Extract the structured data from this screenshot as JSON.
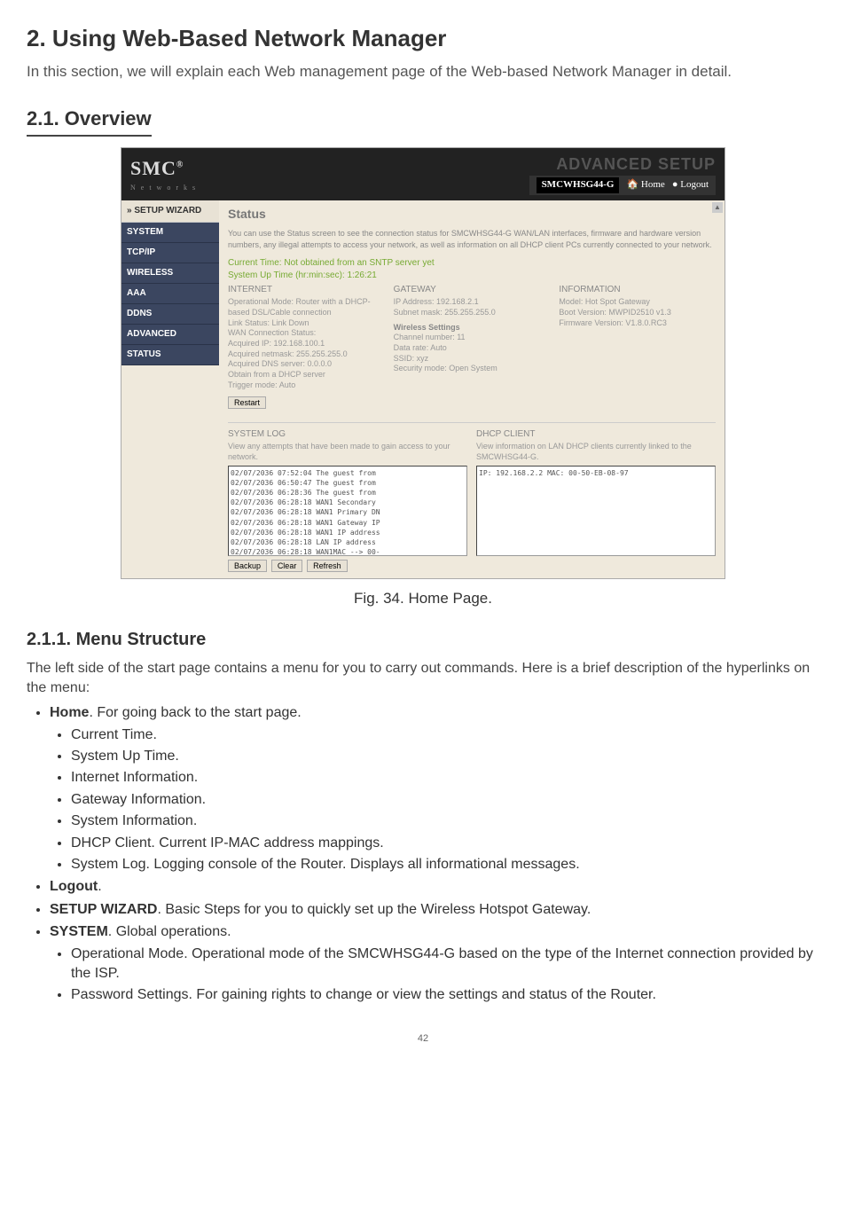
{
  "page": {
    "h1": "2. Using Web-Based Network Manager",
    "intro": "In this section, we will explain each Web management page of the Web-based Network Manager in detail.",
    "h2": "2.1. Overview",
    "caption": "Fig. 34. Home Page.",
    "h3": "2.1.1. Menu Structure",
    "menu_intro": "The left side of the start page contains a menu for you to carry out commands. Here is a brief description of the hyperlinks on the menu:",
    "bul": {
      "home_label": "Home",
      "home_rest": ". For going back to the start page.",
      "home_items": [
        "Current Time.",
        "System Up Time.",
        "Internet Information.",
        "Gateway Information.",
        "System Information.",
        "DHCP Client. Current IP-MAC address mappings.",
        "System Log. Logging console of the Router. Displays all informational messages."
      ],
      "logout": "Logout",
      "wizard_label": "SETUP WIZARD",
      "wizard_rest": ". Basic Steps for you to quickly set up the Wireless Hotspot Gateway.",
      "system_label": "SYSTEM",
      "system_rest": ". Global operations.",
      "system_items": [
        "Operational Mode. Operational mode of the SMCWHSG44-G based on the type of the Internet connection provided by the ISP.",
        "Password Settings. For gaining rights to change or view the settings and status of the Router."
      ]
    },
    "pagenum": "42"
  },
  "shot": {
    "logo": "SMC",
    "logo_sub": "N e t w o r k s",
    "adv": "ADVANCED SETUP",
    "model": "SMCWHSG44-G",
    "home_link": "Home",
    "logout_link": "Logout",
    "sidebar": {
      "wizard": "» SETUP WIZARD",
      "items": [
        "SYSTEM",
        "TCP/IP",
        "WIRELESS",
        "AAA",
        "DDNS",
        "ADVANCED",
        "STATUS"
      ]
    },
    "status": {
      "title": "Status",
      "desc": "You can use the Status screen to see the connection status for SMCWHSG44-G WAN/LAN interfaces, firmware and hardware version numbers, any illegal attempts to access your network, as well as information on all DHCP client PCs currently connected to your network.",
      "time1": "Current Time: Not obtained from an SNTP server yet",
      "time2": "System Up Time (hr:min:sec): 1:26:21",
      "internet_h": "INTERNET",
      "internet_d": "Operational Mode: Router with a DHCP-based DSL/Cable connection",
      "internet_d2": "Link Status: Link Down\nWAN Connection Status:\nAcquired IP: 192.168.100.1\nAcquired netmask: 255.255.255.0\nAcquired DNS server: 0.0.0.0\n  Obtain from a DHCP server\nTrigger mode: Auto",
      "restart": "Restart",
      "gateway_h": "GATEWAY",
      "gateway_d": "IP Address: 192.168.2.1\nSubnet mask: 255.255.255.0",
      "wset_h": "Wireless Settings",
      "wset_d": "Channel number: 11\nData rate: Auto\nSSID: xyz\nSecurity mode: Open System",
      "info_h": "INFORMATION",
      "info_d": "Model: Hot Spot Gateway\nBoot Version: MWPID2510 v1.3\nFirmware Version: V1.8.0.RC3",
      "syslog_h": "SYSTEM LOG",
      "syslog_d": "View any attempts that have been made to gain access to your network.",
      "syslog_content": "02/07/2036 07:52:04 The guest from\n02/07/2036 06:50:47 The guest from\n02/07/2036 06:28:36 The guest from\n02/07/2036 06:28:18 WAN1 Secondary\n02/07/2036 06:28:18 WAN1 Primary DN\n02/07/2036 06:28:18 WAN1 Gateway IP\n02/07/2036 06:28:18 WAN1 IP address\n02/07/2036 06:28:18 LAN IP address\n02/07/2036 06:28:18 WAN1MAC --> 00-",
      "dhcp_h": "DHCP CLIENT",
      "dhcp_d": "View information on LAN DHCP clients currently linked to the SMCWHSG44-G.",
      "dhcp_content": "IP: 192.168.2.2 MAC: 00-50-EB-08-97",
      "btn_backup": "Backup",
      "btn_clear": "Clear",
      "btn_refresh": "Refresh"
    }
  }
}
